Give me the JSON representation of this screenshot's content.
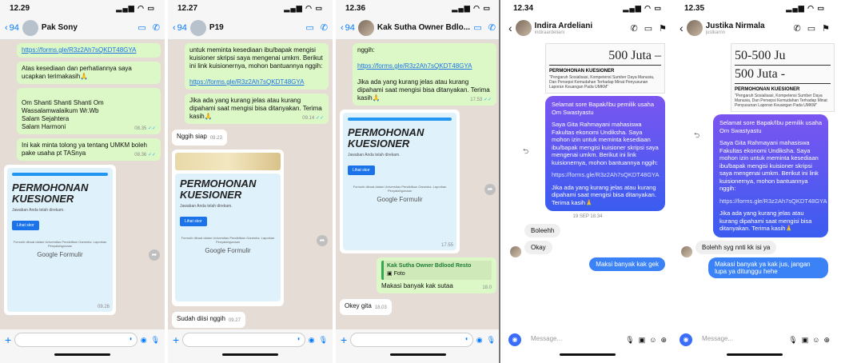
{
  "common": {
    "back_count": "94",
    "input_placeholder_ig": "Message...",
    "form_title": "PERMOHONAN KUESIONER",
    "form_subtitle": "Jawaban Anda telah direkam.",
    "form_button": "Lihat skor",
    "form_fine": "Formulir dibuat dalam Universitas Pendidikan Ganesha. Laporkan Penyalahgunaan",
    "form_brand": "Google Formulir",
    "link": "https://forms.gle/R3z2Ah7sQKDT48GYA"
  },
  "p1": {
    "time": "12.29",
    "name": "Pak Sony",
    "msgs": {
      "m1": "Atas kesediaan dan perhatiannya saya ucapkan terimakasih🙏",
      "m2": "Om Shanti Shanti Shanti Om\nWassalamwalaikum Wr.Wb\nSalam Sejahtera\nSalam Harmoni",
      "m2_time": "08.35",
      "m3": "Ini kak minta tolong ya tentang UMKM boleh pake usaha pt TASnya",
      "m3_time": "08.36",
      "card_time": "09.26"
    }
  },
  "p2": {
    "time": "12.27",
    "name": "P19",
    "msgs": {
      "m1": "untuk meminta kesediaan ibu/bapak mengisi kuisioner skripsi saya mengenai umkm. Berikut ini link kuisionernya, mohon bantuannya nggih:",
      "m2": "Jika ada yang kurang jelas atau kurang dipahami saat mengisi bisa ditanyakan. Terima kasih🙏",
      "m2_time": "09.14",
      "m3": "Nggih siap",
      "m3_time": "09.23",
      "m4": "Sudah diisi nggih",
      "m4_time": "09.27"
    }
  },
  "p3": {
    "time": "12.36",
    "name": "Kak Sutha Owner Bdlo...",
    "msgs": {
      "m0": "nggih:",
      "m1": "Jika ada yang kurang jelas atau kurang dipahami saat mengisi bisa ditanyakan. Terima kasih🙏",
      "m1_time": "17.53",
      "card_time": "17.55",
      "quote_name": "Kak Sutha Owner Bdlood Resto",
      "quote_text": "Foto",
      "m2": "Makasi banyak kak sutaa",
      "m2_time": "18.0",
      "m3": "Okey gita",
      "m3_time": "18.03"
    }
  },
  "p4": {
    "time": "12.34",
    "name": "Indira Ardeliani",
    "handle": "indiraardeliani",
    "doc_big": "500 Juta –",
    "doc_head": "PERMOHONAN KUESIONER",
    "doc_sub": "\"Pengaruh Sosialisasi, Kompetensi Sumber Daya Manusia, Dan Persepsi Kemudahan Terhadap Minat Penyusunan Laporan Keuangan Pada UMKM\"",
    "p_a": "Selamat sore Bapak/Ibu pemilik usaha Om Swastyastu",
    "p_b": "Saya Gita Rahmayani mahasiswa Fakultas ekonomi Undiksha. Saya mohon izin untuk meminta kesediaan ibu/bapak mengisi kuisioner skripsi saya mengenai umkm. Berikut ini link kuisionernya, mohon bantuannya nggih:",
    "p_c": "Jika ada yang kurang jelas atau kurang dipahami saat mengisi bisa ditanyakan. Terima kasih🙏",
    "date": "19 SEP 18.34",
    "r1": "Boleehh",
    "r2": "Okay",
    "s1": "Maksi banyak kak gek"
  },
  "p5": {
    "time": "12.35",
    "name": "Justika Nirmala",
    "handle": "justkarnn",
    "doc_big1": "50-500 Ju",
    "doc_big2": "500 Juta -",
    "doc_head": "PERMOHONAN KUESIONER",
    "doc_sub": "\"Pengaruh Sosialisasi, Kompetensi Sumber Daya Manusia, Dan Persepsi Kemudahan Terhadap Minat Penyusunan Laporan Keuangan Pada UMKM\"",
    "p_a": "Selamat sore Bapak/Ibu pemilik usaha Om Swastyastu",
    "p_b": "Saya Gita Rahmayani mahasiswa Fakultas ekonomi Undiksha. Saya mohon izin untuk meminta kesediaan ibu/bapak mengisi kuisioner skripsi saya mengenai umkm. Berikut ini link kuisionernya, mohon bantuannya nggih:",
    "p_c": "Jika ada yang kurang jelas atau kurang dipahami saat mengisi bisa ditanyakan. Terima kasih🙏",
    "r1": "Bolehh syg nnti kk isi ya",
    "s1": "Makasi banyak ya kak jus, jangan lupa ya ditunggu hehe"
  }
}
